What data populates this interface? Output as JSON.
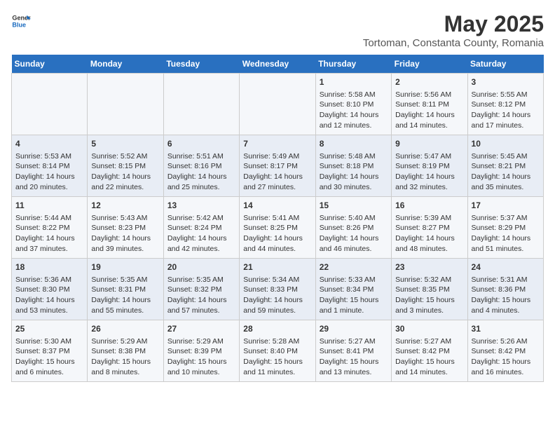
{
  "logo": {
    "general": "General",
    "blue": "Blue"
  },
  "title": "May 2025",
  "subtitle": "Tortoman, Constanta County, Romania",
  "headers": [
    "Sunday",
    "Monday",
    "Tuesday",
    "Wednesday",
    "Thursday",
    "Friday",
    "Saturday"
  ],
  "weeks": [
    [
      {
        "day": "",
        "content": ""
      },
      {
        "day": "",
        "content": ""
      },
      {
        "day": "",
        "content": ""
      },
      {
        "day": "",
        "content": ""
      },
      {
        "day": "1",
        "content": "Sunrise: 5:58 AM\nSunset: 8:10 PM\nDaylight: 14 hours\nand 12 minutes."
      },
      {
        "day": "2",
        "content": "Sunrise: 5:56 AM\nSunset: 8:11 PM\nDaylight: 14 hours\nand 14 minutes."
      },
      {
        "day": "3",
        "content": "Sunrise: 5:55 AM\nSunset: 8:12 PM\nDaylight: 14 hours\nand 17 minutes."
      }
    ],
    [
      {
        "day": "4",
        "content": "Sunrise: 5:53 AM\nSunset: 8:14 PM\nDaylight: 14 hours\nand 20 minutes."
      },
      {
        "day": "5",
        "content": "Sunrise: 5:52 AM\nSunset: 8:15 PM\nDaylight: 14 hours\nand 22 minutes."
      },
      {
        "day": "6",
        "content": "Sunrise: 5:51 AM\nSunset: 8:16 PM\nDaylight: 14 hours\nand 25 minutes."
      },
      {
        "day": "7",
        "content": "Sunrise: 5:49 AM\nSunset: 8:17 PM\nDaylight: 14 hours\nand 27 minutes."
      },
      {
        "day": "8",
        "content": "Sunrise: 5:48 AM\nSunset: 8:18 PM\nDaylight: 14 hours\nand 30 minutes."
      },
      {
        "day": "9",
        "content": "Sunrise: 5:47 AM\nSunset: 8:19 PM\nDaylight: 14 hours\nand 32 minutes."
      },
      {
        "day": "10",
        "content": "Sunrise: 5:45 AM\nSunset: 8:21 PM\nDaylight: 14 hours\nand 35 minutes."
      }
    ],
    [
      {
        "day": "11",
        "content": "Sunrise: 5:44 AM\nSunset: 8:22 PM\nDaylight: 14 hours\nand 37 minutes."
      },
      {
        "day": "12",
        "content": "Sunrise: 5:43 AM\nSunset: 8:23 PM\nDaylight: 14 hours\nand 39 minutes."
      },
      {
        "day": "13",
        "content": "Sunrise: 5:42 AM\nSunset: 8:24 PM\nDaylight: 14 hours\nand 42 minutes."
      },
      {
        "day": "14",
        "content": "Sunrise: 5:41 AM\nSunset: 8:25 PM\nDaylight: 14 hours\nand 44 minutes."
      },
      {
        "day": "15",
        "content": "Sunrise: 5:40 AM\nSunset: 8:26 PM\nDaylight: 14 hours\nand 46 minutes."
      },
      {
        "day": "16",
        "content": "Sunrise: 5:39 AM\nSunset: 8:27 PM\nDaylight: 14 hours\nand 48 minutes."
      },
      {
        "day": "17",
        "content": "Sunrise: 5:37 AM\nSunset: 8:29 PM\nDaylight: 14 hours\nand 51 minutes."
      }
    ],
    [
      {
        "day": "18",
        "content": "Sunrise: 5:36 AM\nSunset: 8:30 PM\nDaylight: 14 hours\nand 53 minutes."
      },
      {
        "day": "19",
        "content": "Sunrise: 5:35 AM\nSunset: 8:31 PM\nDaylight: 14 hours\nand 55 minutes."
      },
      {
        "day": "20",
        "content": "Sunrise: 5:35 AM\nSunset: 8:32 PM\nDaylight: 14 hours\nand 57 minutes."
      },
      {
        "day": "21",
        "content": "Sunrise: 5:34 AM\nSunset: 8:33 PM\nDaylight: 14 hours\nand 59 minutes."
      },
      {
        "day": "22",
        "content": "Sunrise: 5:33 AM\nSunset: 8:34 PM\nDaylight: 15 hours\nand 1 minute."
      },
      {
        "day": "23",
        "content": "Sunrise: 5:32 AM\nSunset: 8:35 PM\nDaylight: 15 hours\nand 3 minutes."
      },
      {
        "day": "24",
        "content": "Sunrise: 5:31 AM\nSunset: 8:36 PM\nDaylight: 15 hours\nand 4 minutes."
      }
    ],
    [
      {
        "day": "25",
        "content": "Sunrise: 5:30 AM\nSunset: 8:37 PM\nDaylight: 15 hours\nand 6 minutes."
      },
      {
        "day": "26",
        "content": "Sunrise: 5:29 AM\nSunset: 8:38 PM\nDaylight: 15 hours\nand 8 minutes."
      },
      {
        "day": "27",
        "content": "Sunrise: 5:29 AM\nSunset: 8:39 PM\nDaylight: 15 hours\nand 10 minutes."
      },
      {
        "day": "28",
        "content": "Sunrise: 5:28 AM\nSunset: 8:40 PM\nDaylight: 15 hours\nand 11 minutes."
      },
      {
        "day": "29",
        "content": "Sunrise: 5:27 AM\nSunset: 8:41 PM\nDaylight: 15 hours\nand 13 minutes."
      },
      {
        "day": "30",
        "content": "Sunrise: 5:27 AM\nSunset: 8:42 PM\nDaylight: 15 hours\nand 14 minutes."
      },
      {
        "day": "31",
        "content": "Sunrise: 5:26 AM\nSunset: 8:42 PM\nDaylight: 15 hours\nand 16 minutes."
      }
    ]
  ]
}
